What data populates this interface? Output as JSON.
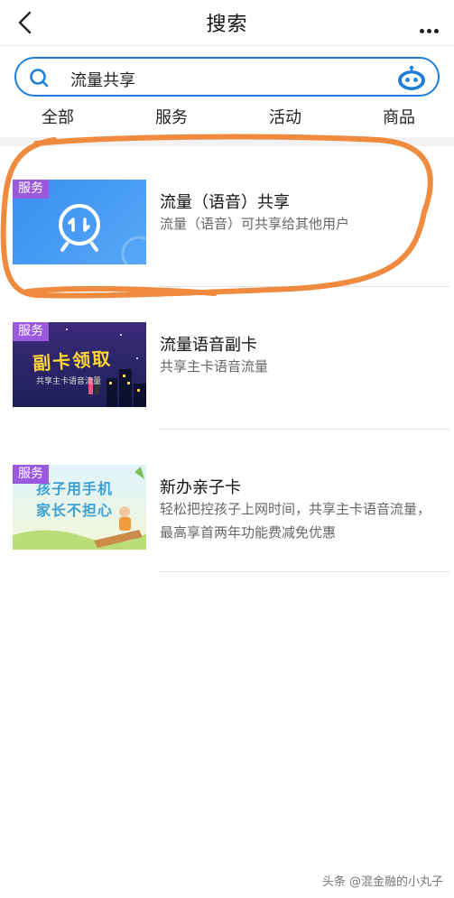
{
  "header": {
    "title": "搜索"
  },
  "search": {
    "query": "流量共享"
  },
  "tabs": [
    {
      "label": "全部"
    },
    {
      "label": "服务"
    },
    {
      "label": "活动"
    },
    {
      "label": "商品"
    }
  ],
  "results": [
    {
      "badge": "服务",
      "title": "流量（语音）共享",
      "desc": "流量（语音）可共享给其他用户"
    },
    {
      "badge": "服务",
      "title": "流量语音副卡",
      "desc": "共享主卡语音流量",
      "thumb_text": "副卡领取",
      "thumb_subtext": "共享主卡语音流量"
    },
    {
      "badge": "服务",
      "title": "新办亲子卡",
      "desc": "轻松把控孩子上网时间，共享主卡语音流量，最高享首两年功能费减免优惠",
      "thumb_text_1": "孩子用手机",
      "thumb_text_2": "家长不担心"
    }
  ],
  "watermark": "头条 @混金融的小丸子",
  "colors": {
    "accent": "#1f7fd6",
    "badge": "#9b59e0",
    "annotation": "#ef8a3e"
  }
}
